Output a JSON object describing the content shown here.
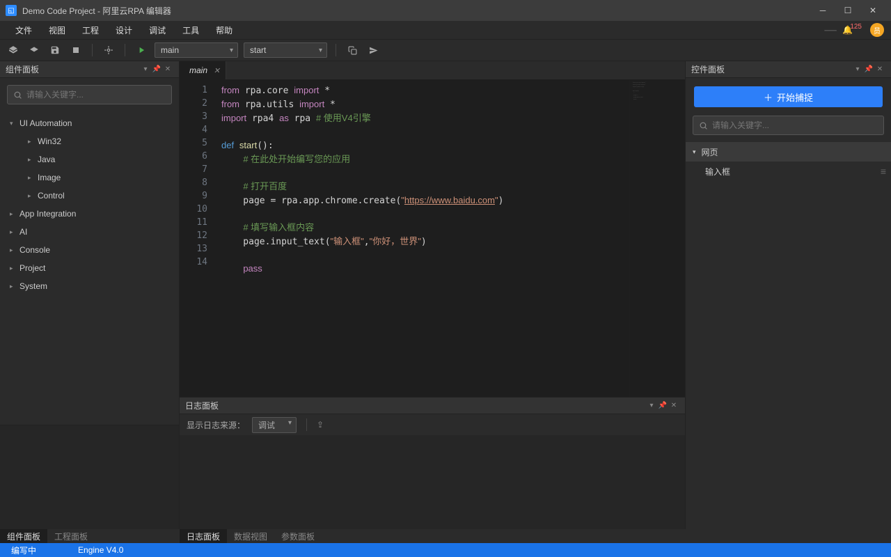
{
  "titlebar": {
    "title": "Demo Code Project - 阿里云RPA 编辑器"
  },
  "menu": {
    "items": [
      "文件",
      "视图",
      "工程",
      "设计",
      "调试",
      "工具",
      "帮助"
    ],
    "badge": "125",
    "avatar_letter": "员"
  },
  "toolbar": {
    "select1": "main",
    "select2": "start"
  },
  "left_panel": {
    "title": "组件面板",
    "search_placeholder": "请输入关键字...",
    "tree": [
      {
        "label": "UI Automation",
        "expanded": true,
        "children": [
          "Win32",
          "Java",
          "Image",
          "Control"
        ]
      },
      {
        "label": "App Integration",
        "expanded": false
      },
      {
        "label": "AI",
        "expanded": false
      },
      {
        "label": "Console",
        "expanded": false
      },
      {
        "label": "Project",
        "expanded": false
      },
      {
        "label": "System",
        "expanded": false
      }
    ]
  },
  "editor": {
    "tab": "main",
    "lines": [
      {
        "n": 1,
        "html": "<span class='kw'>from</span> rpa.core <span class='kw'>import</span> *"
      },
      {
        "n": 2,
        "html": "<span class='kw'>from</span> rpa.utils <span class='kw'>import</span> *"
      },
      {
        "n": 3,
        "html": "<span class='kw'>import</span> rpa4 <span class='kw'>as</span> rpa <span class='cmt'># 使用V4引擎</span>"
      },
      {
        "n": 4,
        "html": ""
      },
      {
        "n": 5,
        "html": "<span class='kw2'>def</span> <span class='fn'>start</span>():"
      },
      {
        "n": 6,
        "html": "    <span class='cmt'># 在此处开始编写您的应用</span>"
      },
      {
        "n": 7,
        "html": ""
      },
      {
        "n": 8,
        "html": "    <span class='cmt'># 打开百度</span>"
      },
      {
        "n": 9,
        "html": "    page = rpa.app.chrome.create(<span class='str'>\"</span><span class='url'>https://www.baidu.com</span><span class='str'>\"</span>)"
      },
      {
        "n": 10,
        "html": ""
      },
      {
        "n": 11,
        "html": "    <span class='cmt'># 填写输入框内容</span>"
      },
      {
        "n": 12,
        "html": "    page.input_text(<span class='str'>\"输入框\"</span>,<span class='str'>\"你好，世界\"</span>)"
      },
      {
        "n": 13,
        "html": ""
      },
      {
        "n": 14,
        "html": "    <span class='kw'>pass</span>"
      }
    ]
  },
  "log_panel": {
    "title": "日志面板",
    "source_label": "显示日志来源：",
    "source_value": "调试"
  },
  "right_panel": {
    "title": "控件面板",
    "capture_btn": "开始捕捉",
    "search_placeholder": "请输入关键字...",
    "category": "网页",
    "items": [
      "输入框"
    ]
  },
  "bottom_tabs": {
    "left": [
      {
        "l": "组件面板",
        "a": true
      },
      {
        "l": "工程面板",
        "a": false
      }
    ],
    "center": [
      {
        "l": "日志面板",
        "a": true
      },
      {
        "l": "数据视图",
        "a": false
      },
      {
        "l": "参数面板",
        "a": false
      }
    ]
  },
  "status": {
    "mode": "编写中",
    "engine": "Engine V4.0"
  }
}
